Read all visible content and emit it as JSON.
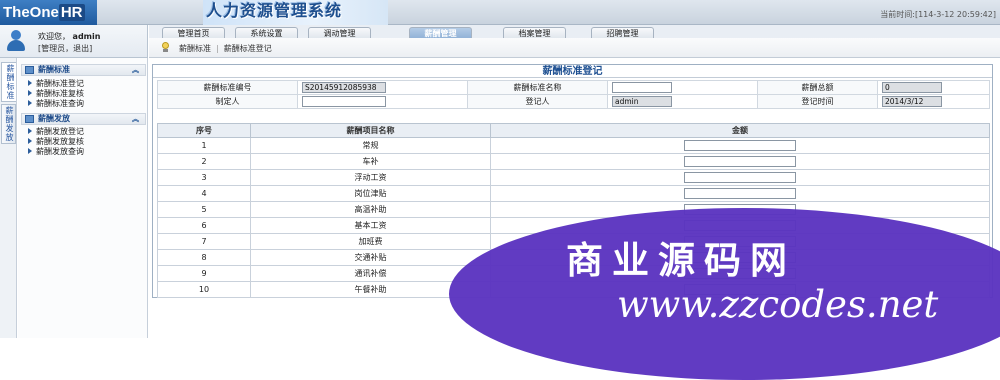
{
  "header": {
    "logo_text_a": "TheOne",
    "logo_text_b": "HR",
    "app_title": "人力资源管理系统",
    "current_time": "当前时间:[114-3-12 20:59:42]"
  },
  "user": {
    "welcome": "欢迎您，",
    "name": "admin",
    "role": "[管理员，",
    "logout": "退出]"
  },
  "tabs": [
    {
      "label": "管理首页",
      "active": false
    },
    {
      "label": "系统设置",
      "active": false
    },
    {
      "label": "调动管理",
      "active": false
    },
    {
      "label": "薪酬管理",
      "active": true
    },
    {
      "label": "档案管理",
      "active": false
    },
    {
      "label": "招聘管理",
      "active": false
    }
  ],
  "breadcrumb": [
    "薪酬标准",
    "薪酬标准登记"
  ],
  "vertical_tabs": [
    "薪酬标准",
    "薪酬发放"
  ],
  "sidebar": {
    "groups": [
      {
        "title": "薪酬标准",
        "items": [
          "薪酬标准登记",
          "薪酬标准复核",
          "薪酬标准查询"
        ]
      },
      {
        "title": "薪酬发放",
        "items": [
          "薪酬发放登记",
          "薪酬发放复核",
          "薪酬发放查询"
        ]
      }
    ],
    "collapse_icon": "double-chevron-up-icon"
  },
  "form": {
    "title": "薪酬标准登记",
    "fields": {
      "std_no_label": "薪酬标准编号",
      "std_no_value": "S20145912085938",
      "std_name_label": "薪酬标准名称",
      "std_name_value": "",
      "total_label": "薪酬总额",
      "total_value": "0",
      "maker_label": "制定人",
      "maker_value": "",
      "registrar_label": "登记人",
      "registrar_value": "admin",
      "reg_time_label": "登记时间",
      "reg_time_value": "2014/3/12"
    },
    "items_header": {
      "no": "序号",
      "name": "薪酬项目名称",
      "amount": "金额"
    },
    "items": [
      {
        "no": "1",
        "name": "常规"
      },
      {
        "no": "2",
        "name": "车补"
      },
      {
        "no": "3",
        "name": "浮动工资"
      },
      {
        "no": "4",
        "name": "岗位津贴"
      },
      {
        "no": "5",
        "name": "高温补助"
      },
      {
        "no": "6",
        "name": "基本工资"
      },
      {
        "no": "7",
        "name": "加班费"
      },
      {
        "no": "8",
        "name": "交通补贴"
      },
      {
        "no": "9",
        "name": "通讯补偿"
      },
      {
        "no": "10",
        "name": "午餐补助"
      }
    ]
  },
  "watermark": {
    "cn": "商业源码网",
    "url": "www.zzcodes.net"
  }
}
